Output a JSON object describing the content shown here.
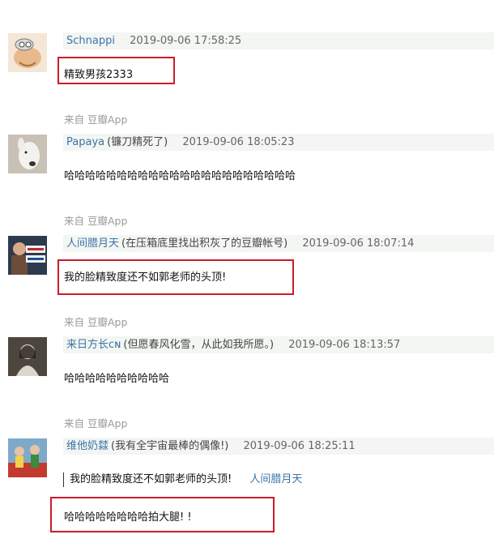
{
  "comments": [
    {
      "author": "Schnappi",
      "signature": "",
      "time": "2019-09-06 17:58:25",
      "content": "精致男孩2333",
      "source": "来自 豆瓣App"
    },
    {
      "author": "Papaya",
      "signature": "(镰刀精死了)",
      "time": "2019-09-06 18:05:23",
      "content": "哈哈哈哈哈哈哈哈哈哈哈哈哈哈哈哈哈哈哈哈哈哈",
      "source": "来自 豆瓣App"
    },
    {
      "author": "人间腊月天",
      "signature": "(在压箱底里找出积灰了的豆瓣帐号)",
      "time": "2019-09-06 18:07:14",
      "content": "我的脸精致度还不如郭老师的头顶!",
      "source": "来自 豆瓣App"
    },
    {
      "author": "来日方长ᴄɴ",
      "signature": "(但愿春风化雪，从此如我所愿。)",
      "time": "2019-09-06 18:13:57",
      "content": "哈哈哈哈哈哈哈哈哈哈",
      "source": "来自 豆瓣App"
    },
    {
      "author": "维他奶㵘",
      "signature": "(我有全宇宙最棒的偶像!)",
      "time": "2019-09-06 18:25:11",
      "quote_text": "我的脸精致度还不如郭老师的头顶!",
      "quote_author": "人间腊月天",
      "content": "哈哈哈哈哈哈哈哈拍大腿! !"
    }
  ]
}
